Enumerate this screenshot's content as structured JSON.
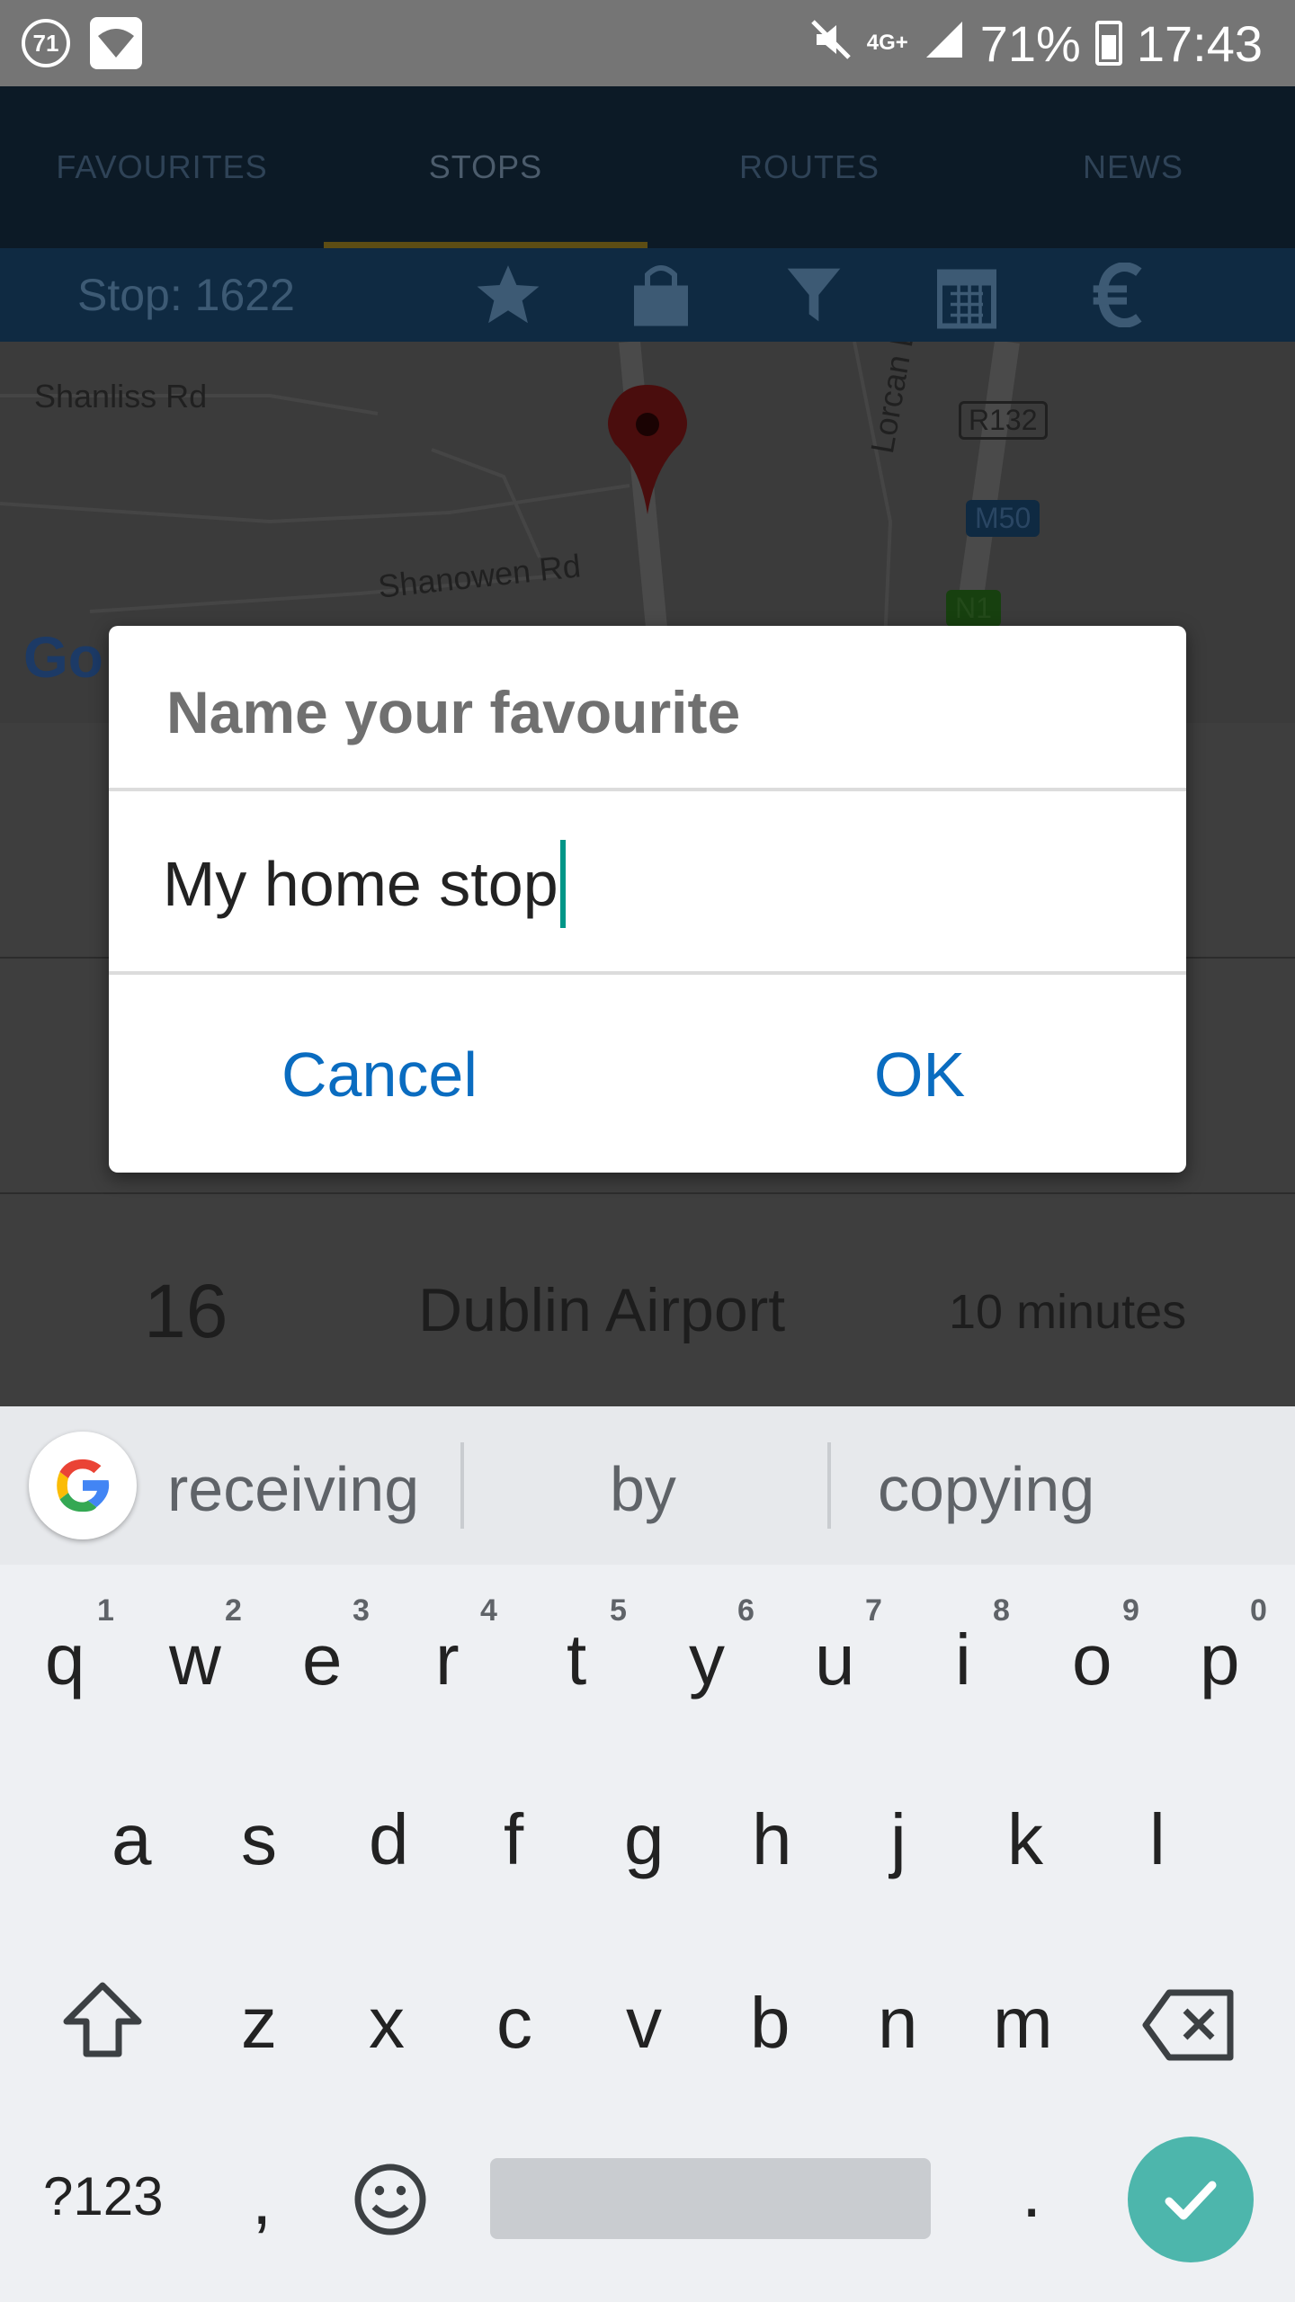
{
  "status_bar": {
    "badge": "71",
    "network": "4G+",
    "battery": "71%",
    "time": "17:43"
  },
  "tabs": [
    "FAVOURITES",
    "STOPS",
    "ROUTES",
    "NEWS"
  ],
  "toolbar": {
    "stop_label": "Stop: 1622"
  },
  "map": {
    "labels": {
      "shanliss": "Shanliss Rd",
      "shanowen": "Shanowen Rd",
      "lorcan": "Lorcan Dr",
      "r132": "R132",
      "m50": "M50",
      "n1": "N1",
      "google": "Go"
    }
  },
  "departure_row": {
    "route": "16",
    "destination": "Dublin Airport",
    "time": "10 minutes"
  },
  "dialog": {
    "title": "Name your favourite",
    "input_value": "My home stop",
    "cancel_label": "Cancel",
    "ok_label": "OK"
  },
  "keyboard": {
    "suggestions": [
      "receiving",
      "by",
      "copying"
    ],
    "row1": [
      "q",
      "w",
      "e",
      "r",
      "t",
      "y",
      "u",
      "i",
      "o",
      "p"
    ],
    "row1_hints": [
      "1",
      "2",
      "3",
      "4",
      "5",
      "6",
      "7",
      "8",
      "9",
      "0"
    ],
    "row2": [
      "a",
      "s",
      "d",
      "f",
      "g",
      "h",
      "j",
      "k",
      "l"
    ],
    "row3": [
      "z",
      "x",
      "c",
      "v",
      "b",
      "n",
      "m"
    ],
    "symbols_label": "?123",
    "comma": ",",
    "period": "."
  },
  "colors": {
    "accent": "#0a6cc0",
    "caret": "#009688",
    "enter": "#4db6ac"
  }
}
